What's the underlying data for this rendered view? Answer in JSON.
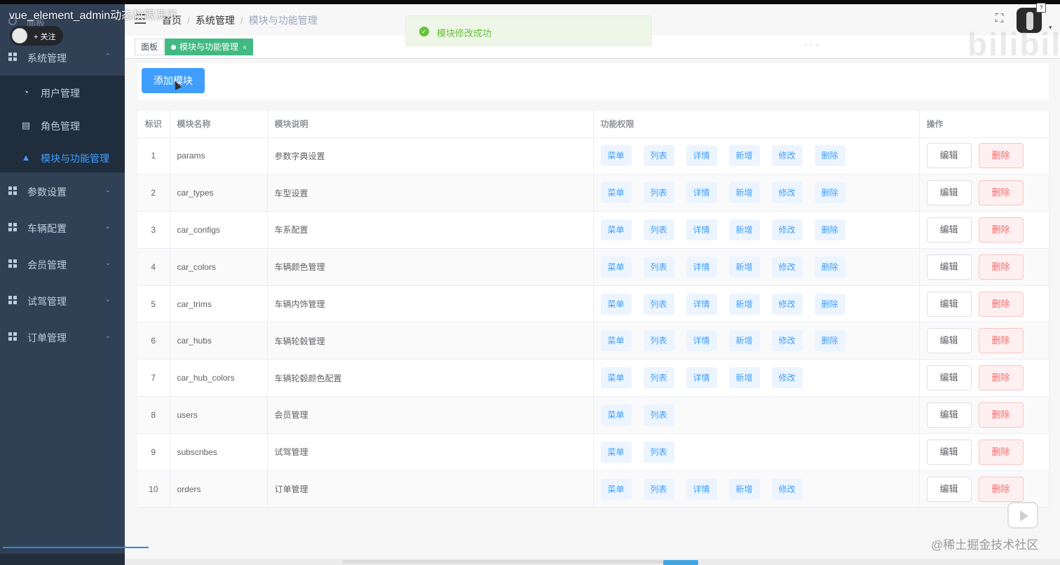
{
  "video_overlay": {
    "title": "vue_element_admin动态权限演示",
    "follow_label": "+ 关注",
    "help_badge": "?",
    "watermark": "@稀土掘金技术社区",
    "bili_watermark": "bilibili"
  },
  "sidebar": {
    "dashboard_label": "面板",
    "groups": [
      {
        "label": "系统管理",
        "expanded": true,
        "arrow": "⌃"
      },
      {
        "label": "参数设置",
        "expanded": false,
        "arrow": "⌄"
      },
      {
        "label": "车辆配置",
        "expanded": false,
        "arrow": "⌄"
      },
      {
        "label": "会员管理",
        "expanded": false,
        "arrow": "⌄"
      },
      {
        "label": "试驾管理",
        "expanded": false,
        "arrow": "⌄"
      },
      {
        "label": "订单管理",
        "expanded": false,
        "arrow": "⌄"
      }
    ],
    "sub_items": [
      {
        "label": "用户管理",
        "icon": "dashboard-icon",
        "glyph": "◔"
      },
      {
        "label": "角色管理",
        "icon": "document-icon",
        "glyph": "▤"
      },
      {
        "label": "模块与功能管理",
        "icon": "lock-icon",
        "glyph": "▲",
        "active": true
      }
    ]
  },
  "navbar": {
    "breadcrumb": [
      "首页",
      "系统管理",
      "模块与功能管理"
    ],
    "separator": "/",
    "fullscreen_glyph": "⛶",
    "caret": "▾"
  },
  "toast": {
    "icon": "✓",
    "text": "模块修改成功",
    "status_color": "#67c23a"
  },
  "tags": [
    {
      "label": "面板",
      "active": false
    },
    {
      "label": "模块与功能管理",
      "active": true,
      "close": "×"
    }
  ],
  "toolbar": {
    "add_label": "添加模块",
    "accent": "#409eff"
  },
  "table": {
    "columns": [
      "标识",
      "模块名称",
      "模块说明",
      "功能权限",
      "操作"
    ],
    "edit_label": "编辑",
    "delete_label": "删除",
    "rows": [
      {
        "id": "1",
        "name": "params",
        "desc": "参数字典设置",
        "perms": [
          "菜单",
          "列表",
          "详情",
          "新增",
          "修改",
          "删除"
        ]
      },
      {
        "id": "2",
        "name": "car_types",
        "desc": "车型设置",
        "perms": [
          "菜单",
          "列表",
          "详情",
          "新增",
          "修改",
          "删除"
        ]
      },
      {
        "id": "3",
        "name": "car_configs",
        "desc": "车系配置",
        "perms": [
          "菜单",
          "列表",
          "详情",
          "新增",
          "修改",
          "删除"
        ]
      },
      {
        "id": "4",
        "name": "car_colors",
        "desc": "车辆颜色管理",
        "perms": [
          "菜单",
          "列表",
          "详情",
          "新增",
          "修改",
          "删除"
        ]
      },
      {
        "id": "5",
        "name": "car_trims",
        "desc": "车辆内饰管理",
        "perms": [
          "菜单",
          "列表",
          "详情",
          "新增",
          "修改",
          "删除"
        ]
      },
      {
        "id": "6",
        "name": "car_hubs",
        "desc": "车辆轮毂管理",
        "perms": [
          "菜单",
          "列表",
          "详情",
          "新增",
          "修改",
          "删除"
        ]
      },
      {
        "id": "7",
        "name": "car_hub_colors",
        "desc": "车辆轮毂颜色配置",
        "perms": [
          "菜单",
          "列表",
          "详情",
          "新增",
          "修改"
        ]
      },
      {
        "id": "8",
        "name": "users",
        "desc": "会员管理",
        "perms": [
          "菜单",
          "列表"
        ]
      },
      {
        "id": "9",
        "name": "subscribes",
        "desc": "试驾管理",
        "perms": [
          "菜单",
          "列表"
        ]
      },
      {
        "id": "10",
        "name": "orders",
        "desc": "订单管理",
        "perms": [
          "菜单",
          "列表",
          "详情",
          "新增",
          "修改"
        ]
      }
    ]
  }
}
